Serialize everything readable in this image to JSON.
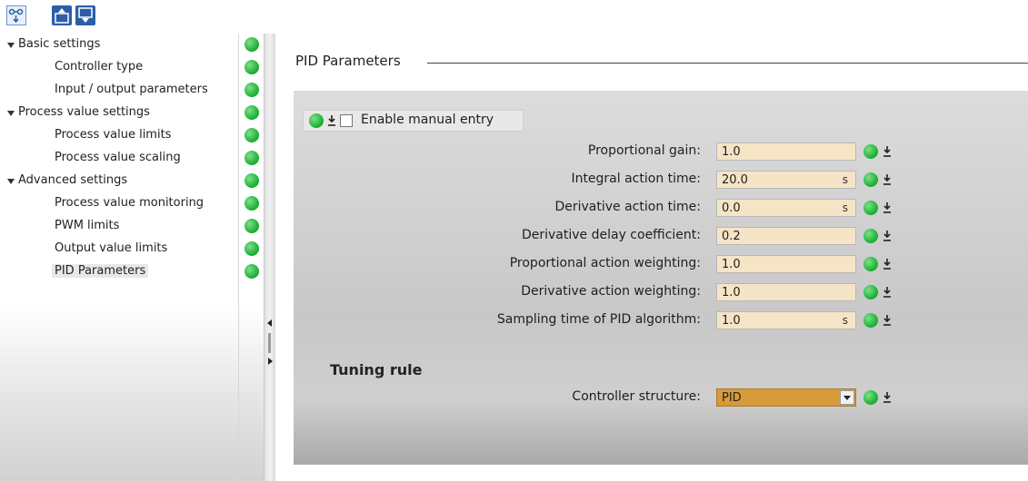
{
  "toolbar": {
    "buttons": [
      "functional-view-icon",
      "expand-all-icon",
      "collapse-all-icon"
    ]
  },
  "nav": {
    "items": [
      {
        "label": "Basic settings",
        "level": 0,
        "expanded": true
      },
      {
        "label": "Controller type",
        "level": 1
      },
      {
        "label": "Input / output parameters",
        "level": 1
      },
      {
        "label": "Process value settings",
        "level": 0,
        "expanded": true
      },
      {
        "label": "Process value limits",
        "level": 1
      },
      {
        "label": "Process value scaling",
        "level": 1
      },
      {
        "label": "Advanced settings",
        "level": 0,
        "expanded": true
      },
      {
        "label": "Process value monitoring",
        "level": 1
      },
      {
        "label": "PWM limits",
        "level": 1
      },
      {
        "label": "Output value limits",
        "level": 1
      },
      {
        "label": "PID Parameters",
        "level": 1,
        "selected": true
      }
    ],
    "status_color": "#22b43a"
  },
  "main": {
    "section_title": "PID Parameters",
    "manual_entry": {
      "label": "Enable manual entry",
      "checked": false
    },
    "parameters": [
      {
        "label": "Proportional gain:",
        "value": "1.0",
        "unit": ""
      },
      {
        "label": "Integral action time:",
        "value": "20.0",
        "unit": "s"
      },
      {
        "label": "Derivative action time:",
        "value": "0.0",
        "unit": "s"
      },
      {
        "label": "Derivative delay coefficient:",
        "value": "0.2",
        "unit": ""
      },
      {
        "label": "Proportional action weighting:",
        "value": "1.0",
        "unit": ""
      },
      {
        "label": "Derivative action weighting:",
        "value": "1.0",
        "unit": ""
      },
      {
        "label": "Sampling time of PID algorithm:",
        "value": "1.0",
        "unit": "s"
      }
    ],
    "tuning": {
      "title": "Tuning rule",
      "controller_structure_label": "Controller structure:",
      "controller_structure_value": "PID"
    },
    "input_bg": "#f6e4c6",
    "select_bg": "#d99a3a"
  }
}
